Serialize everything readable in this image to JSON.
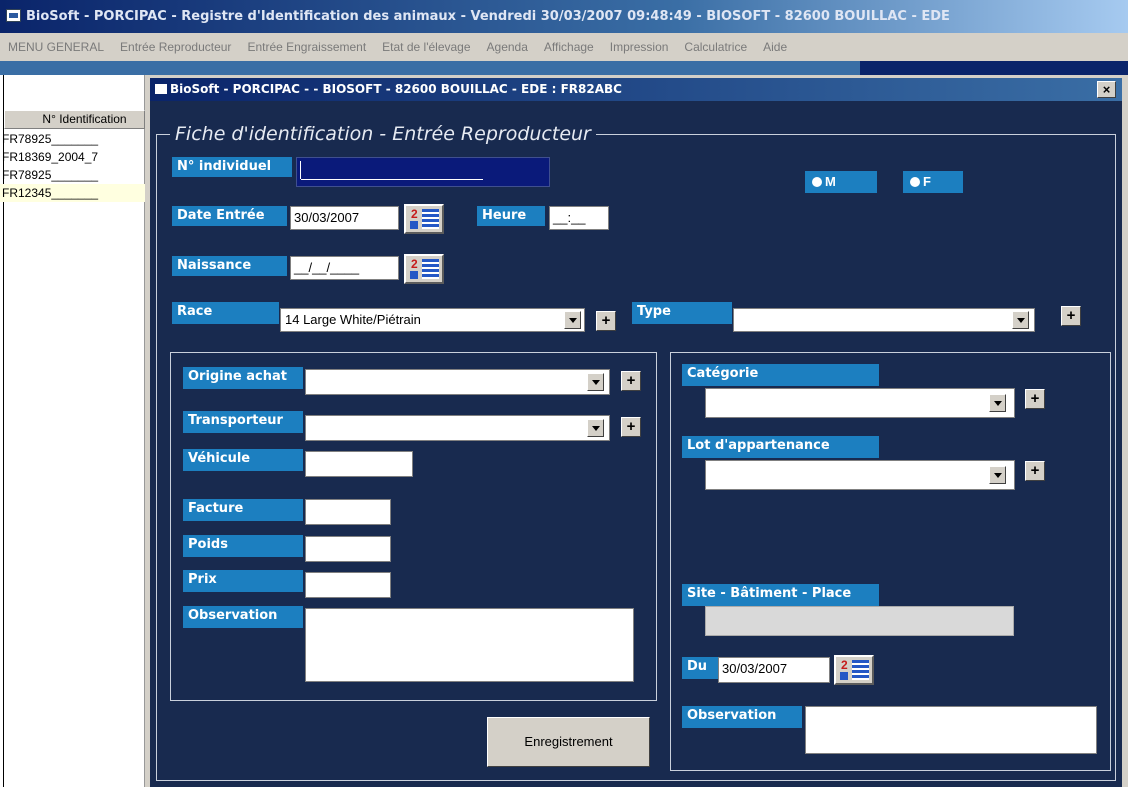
{
  "window": {
    "title": "BioSoft - PORCIPAC - Registre d'Identification des animaux  -  Vendredi  30/03/2007 09:48:49 - BIOSOFT - 82600 BOUILLAC - EDE"
  },
  "menu": [
    "MENU GENERAL",
    "Entrée Reproducteur",
    "Entrée Engraissement",
    "Etat de l'élevage",
    "Agenda",
    "Affichage",
    "Impression",
    "Calculatrice",
    "Aide"
  ],
  "list": {
    "header": "N° Identification",
    "rows": [
      "FR78925_______",
      "FR18369_2004_7",
      "FR78925_______",
      "FR12345_______"
    ]
  },
  "dialog": {
    "title": "BioSoft - PORCIPAC -  - BIOSOFT - 82600 BOUILLAC - EDE : FR82ABC",
    "close": "×",
    "legend": "Fiche d'identification - Entrée Reproducteur"
  },
  "form": {
    "individuel_label": "N° individuel",
    "individuel_value": "",
    "sex_m": "M",
    "sex_f": "F",
    "date_entree_label": "Date Entrée",
    "date_entree_value": "30/03/2007",
    "heure_label": "Heure",
    "heure_value": "__:__",
    "naissance_label": "Naissance",
    "naissance_value": "__/__/____",
    "race_label": "Race",
    "race_value": "14 Large White/Piétrain",
    "type_label": "Type",
    "type_value": "",
    "origine_label": "Origine achat",
    "transporteur_label": "Transporteur",
    "vehicule_label": "Véhicule",
    "facture_label": "Facture",
    "poids_label": "Poids",
    "prix_label": "Prix",
    "observation_label": "Observation",
    "categorie_label": "Catégorie",
    "lot_label": "Lot d'appartenance",
    "site_label": "Site - Bâtiment - Place",
    "du_label": "Du",
    "du_value": "30/03/2007",
    "observation2_label": "Observation",
    "save_label": "Enregistrement",
    "plus": "+",
    "cal_num": "2"
  }
}
